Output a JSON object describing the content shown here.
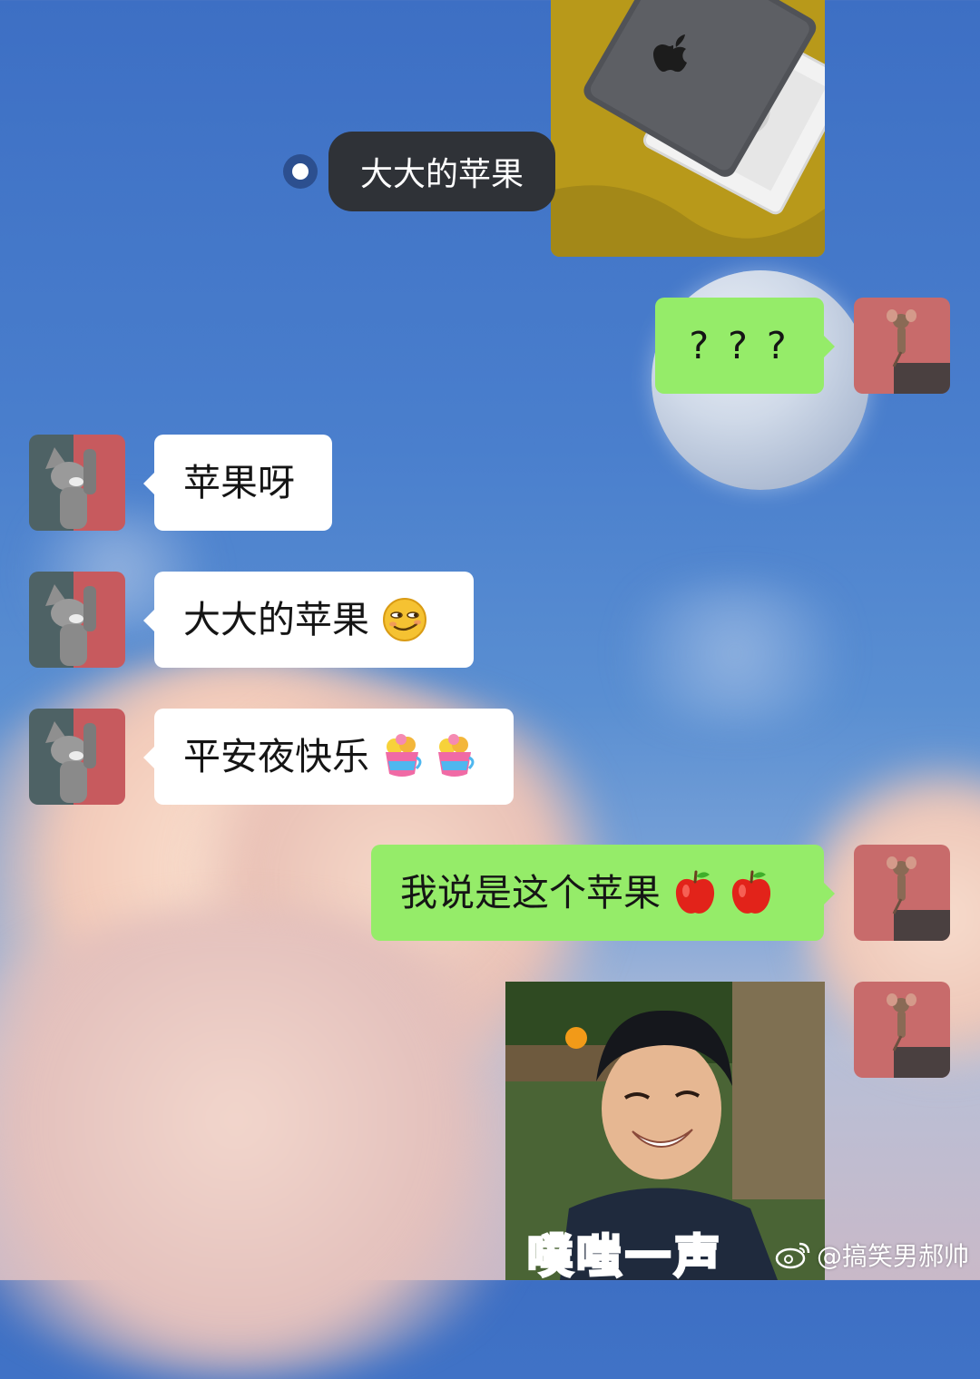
{
  "chat": {
    "pill_label": "大大的苹果",
    "messages": [
      {
        "side": "right",
        "text": "? ? ?"
      },
      {
        "side": "left",
        "text": "苹果呀"
      },
      {
        "side": "left",
        "text": "大大的苹果"
      },
      {
        "side": "left",
        "text": "平安夜快乐"
      },
      {
        "side": "right",
        "text": "我说是这个苹果"
      }
    ],
    "image_caption": "噗嗤一声"
  },
  "watermark": {
    "text": "@搞笑男郝帅"
  },
  "icons": {
    "pill_dot": "record-dot-icon",
    "emoji_smirk": "smirk-face-emoji",
    "emoji_cake": "celebration-cup-emoji",
    "emoji_apple": "red-apple-emoji",
    "weibo": "weibo-logo-icon"
  },
  "colors": {
    "bubble_green": "#95ec69",
    "bubble_white": "#ffffff",
    "pill_dark": "#2f3237"
  }
}
